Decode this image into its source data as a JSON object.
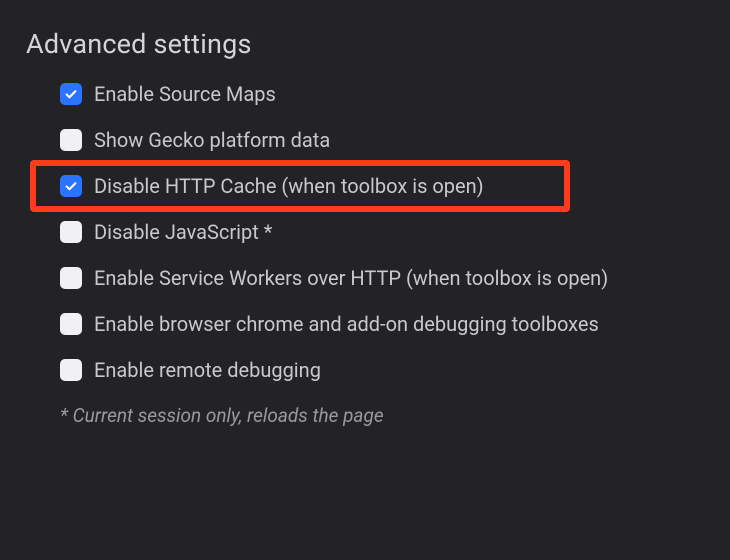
{
  "section": {
    "title": "Advanced settings",
    "footnote": "* Current session only, reloads the page"
  },
  "options": [
    {
      "label": "Enable Source Maps",
      "checked": true,
      "highlighted": false
    },
    {
      "label": "Show Gecko platform data",
      "checked": false,
      "highlighted": false
    },
    {
      "label": "Disable HTTP Cache (when toolbox is open)",
      "checked": true,
      "highlighted": true
    },
    {
      "label": "Disable JavaScript *",
      "checked": false,
      "highlighted": false
    },
    {
      "label": "Enable Service Workers over HTTP (when toolbox is open)",
      "checked": false,
      "highlighted": false
    },
    {
      "label": "Enable browser chrome and add-on debugging toolboxes",
      "checked": false,
      "highlighted": false
    },
    {
      "label": "Enable remote debugging",
      "checked": false,
      "highlighted": false
    }
  ],
  "highlight": {
    "color": "#ff3b1f"
  }
}
